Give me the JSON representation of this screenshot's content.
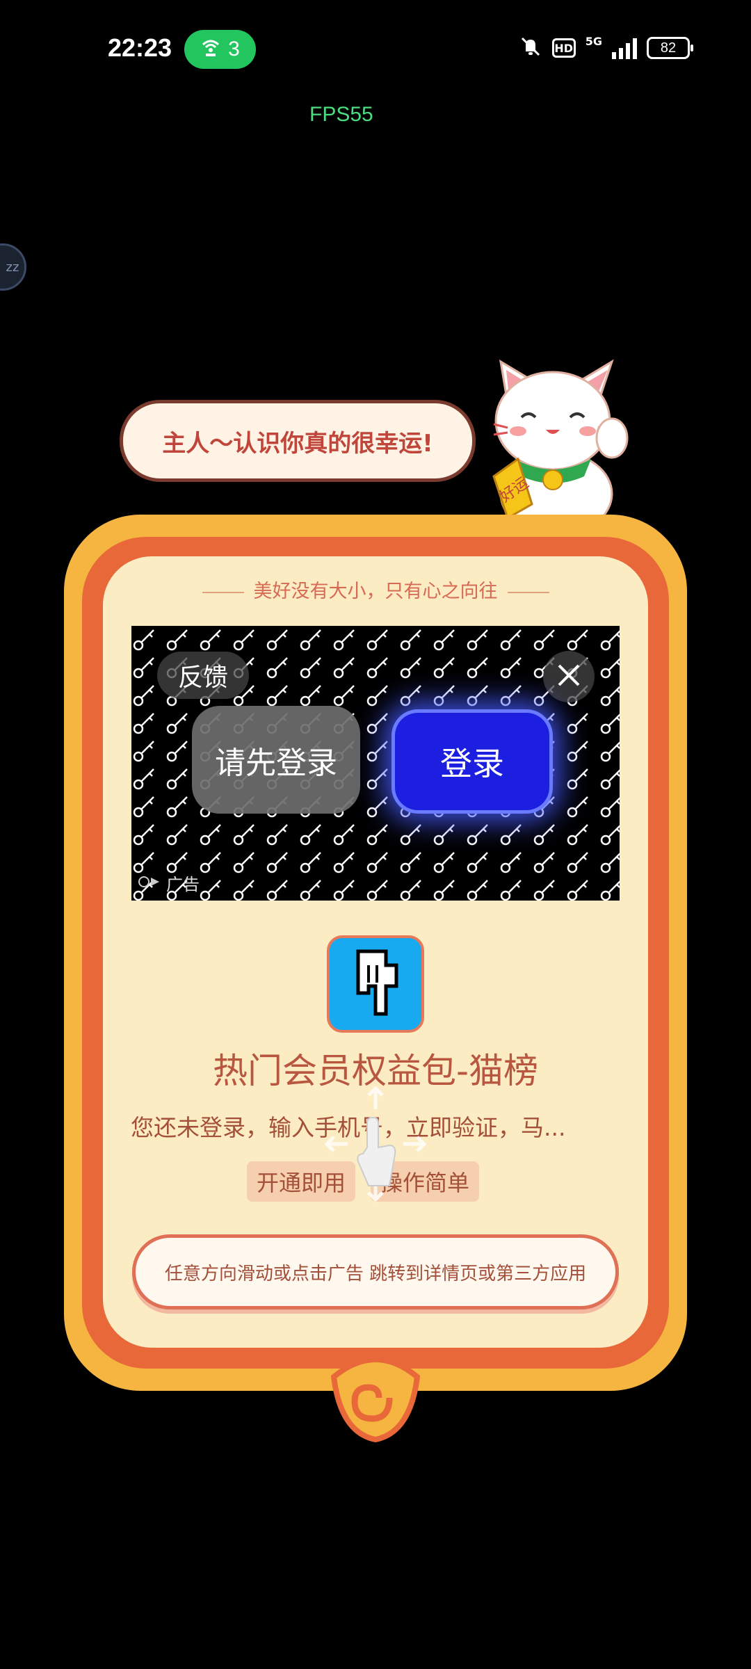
{
  "status_bar": {
    "time": "22:23",
    "hotspot_count": "3",
    "hd": "HD",
    "network": "5G",
    "battery": "82"
  },
  "fps": "FPS55",
  "floating_ball": "zz",
  "bubble": {
    "text": "主人～认识你真的很幸运!"
  },
  "cat": {
    "tag": "好运"
  },
  "motto": "美好没有大小，只有心之向往",
  "ad": {
    "feedback_label": "反馈",
    "login_hint": "请先登录",
    "login_button": "登录",
    "ad_label": "广告"
  },
  "app": {
    "title": "热门会员权益包-猫榜",
    "description": "您还未登录，输入手机号，立即验证，马...",
    "tags": [
      "开通即用",
      "操作简单"
    ]
  },
  "cta": "任意方向滑动或点击广告 跳转到详情页或第三方应用",
  "colors": {
    "frame_gold": "#f5b540",
    "frame_orange": "#e8683a",
    "panel_cream": "#fcecc4",
    "login_blue": "#1c1fe0",
    "hotspot_green": "#22c55e",
    "text_brown": "#a34f3a"
  }
}
